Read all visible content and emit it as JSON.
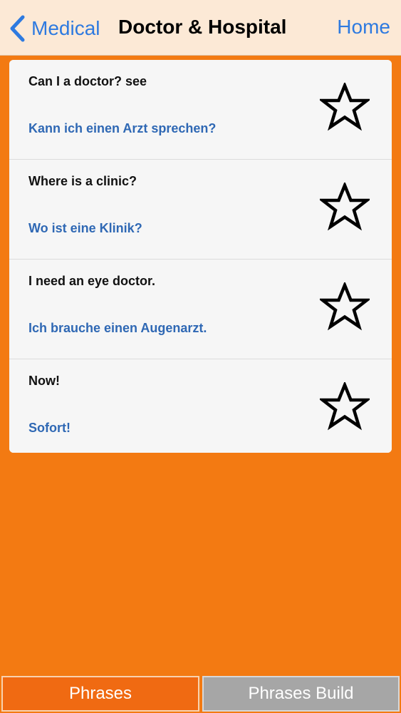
{
  "navbar": {
    "back_label": "Medical",
    "back_icon": "chevron-left-icon",
    "title": "Doctor & Hospital",
    "home_label": "Home",
    "accent_color": "#2E7AE0",
    "background_color": "#FCE9D6"
  },
  "phrases": [
    {
      "english": "Can I a doctor? see",
      "german": "Kann ich einen Arzt sprechen?",
      "favorite": false
    },
    {
      "english": "Where is a clinic?",
      "german": "Wo ist eine Klinik?",
      "favorite": false
    },
    {
      "english": "I need an eye doctor.",
      "german": "Ich brauche einen Augenarzt.",
      "favorite": false
    },
    {
      "english": "Now!",
      "german": "Sofort!",
      "favorite": false
    }
  ],
  "tabs": [
    {
      "label": "Phrases",
      "selected": true
    },
    {
      "label": "Phrases Build",
      "selected": false
    }
  ],
  "colors": {
    "background": "#F37A12",
    "translation_text": "#2F68B4",
    "selected_tab": "#F06A12",
    "unselected_tab": "#A6A6A6"
  }
}
